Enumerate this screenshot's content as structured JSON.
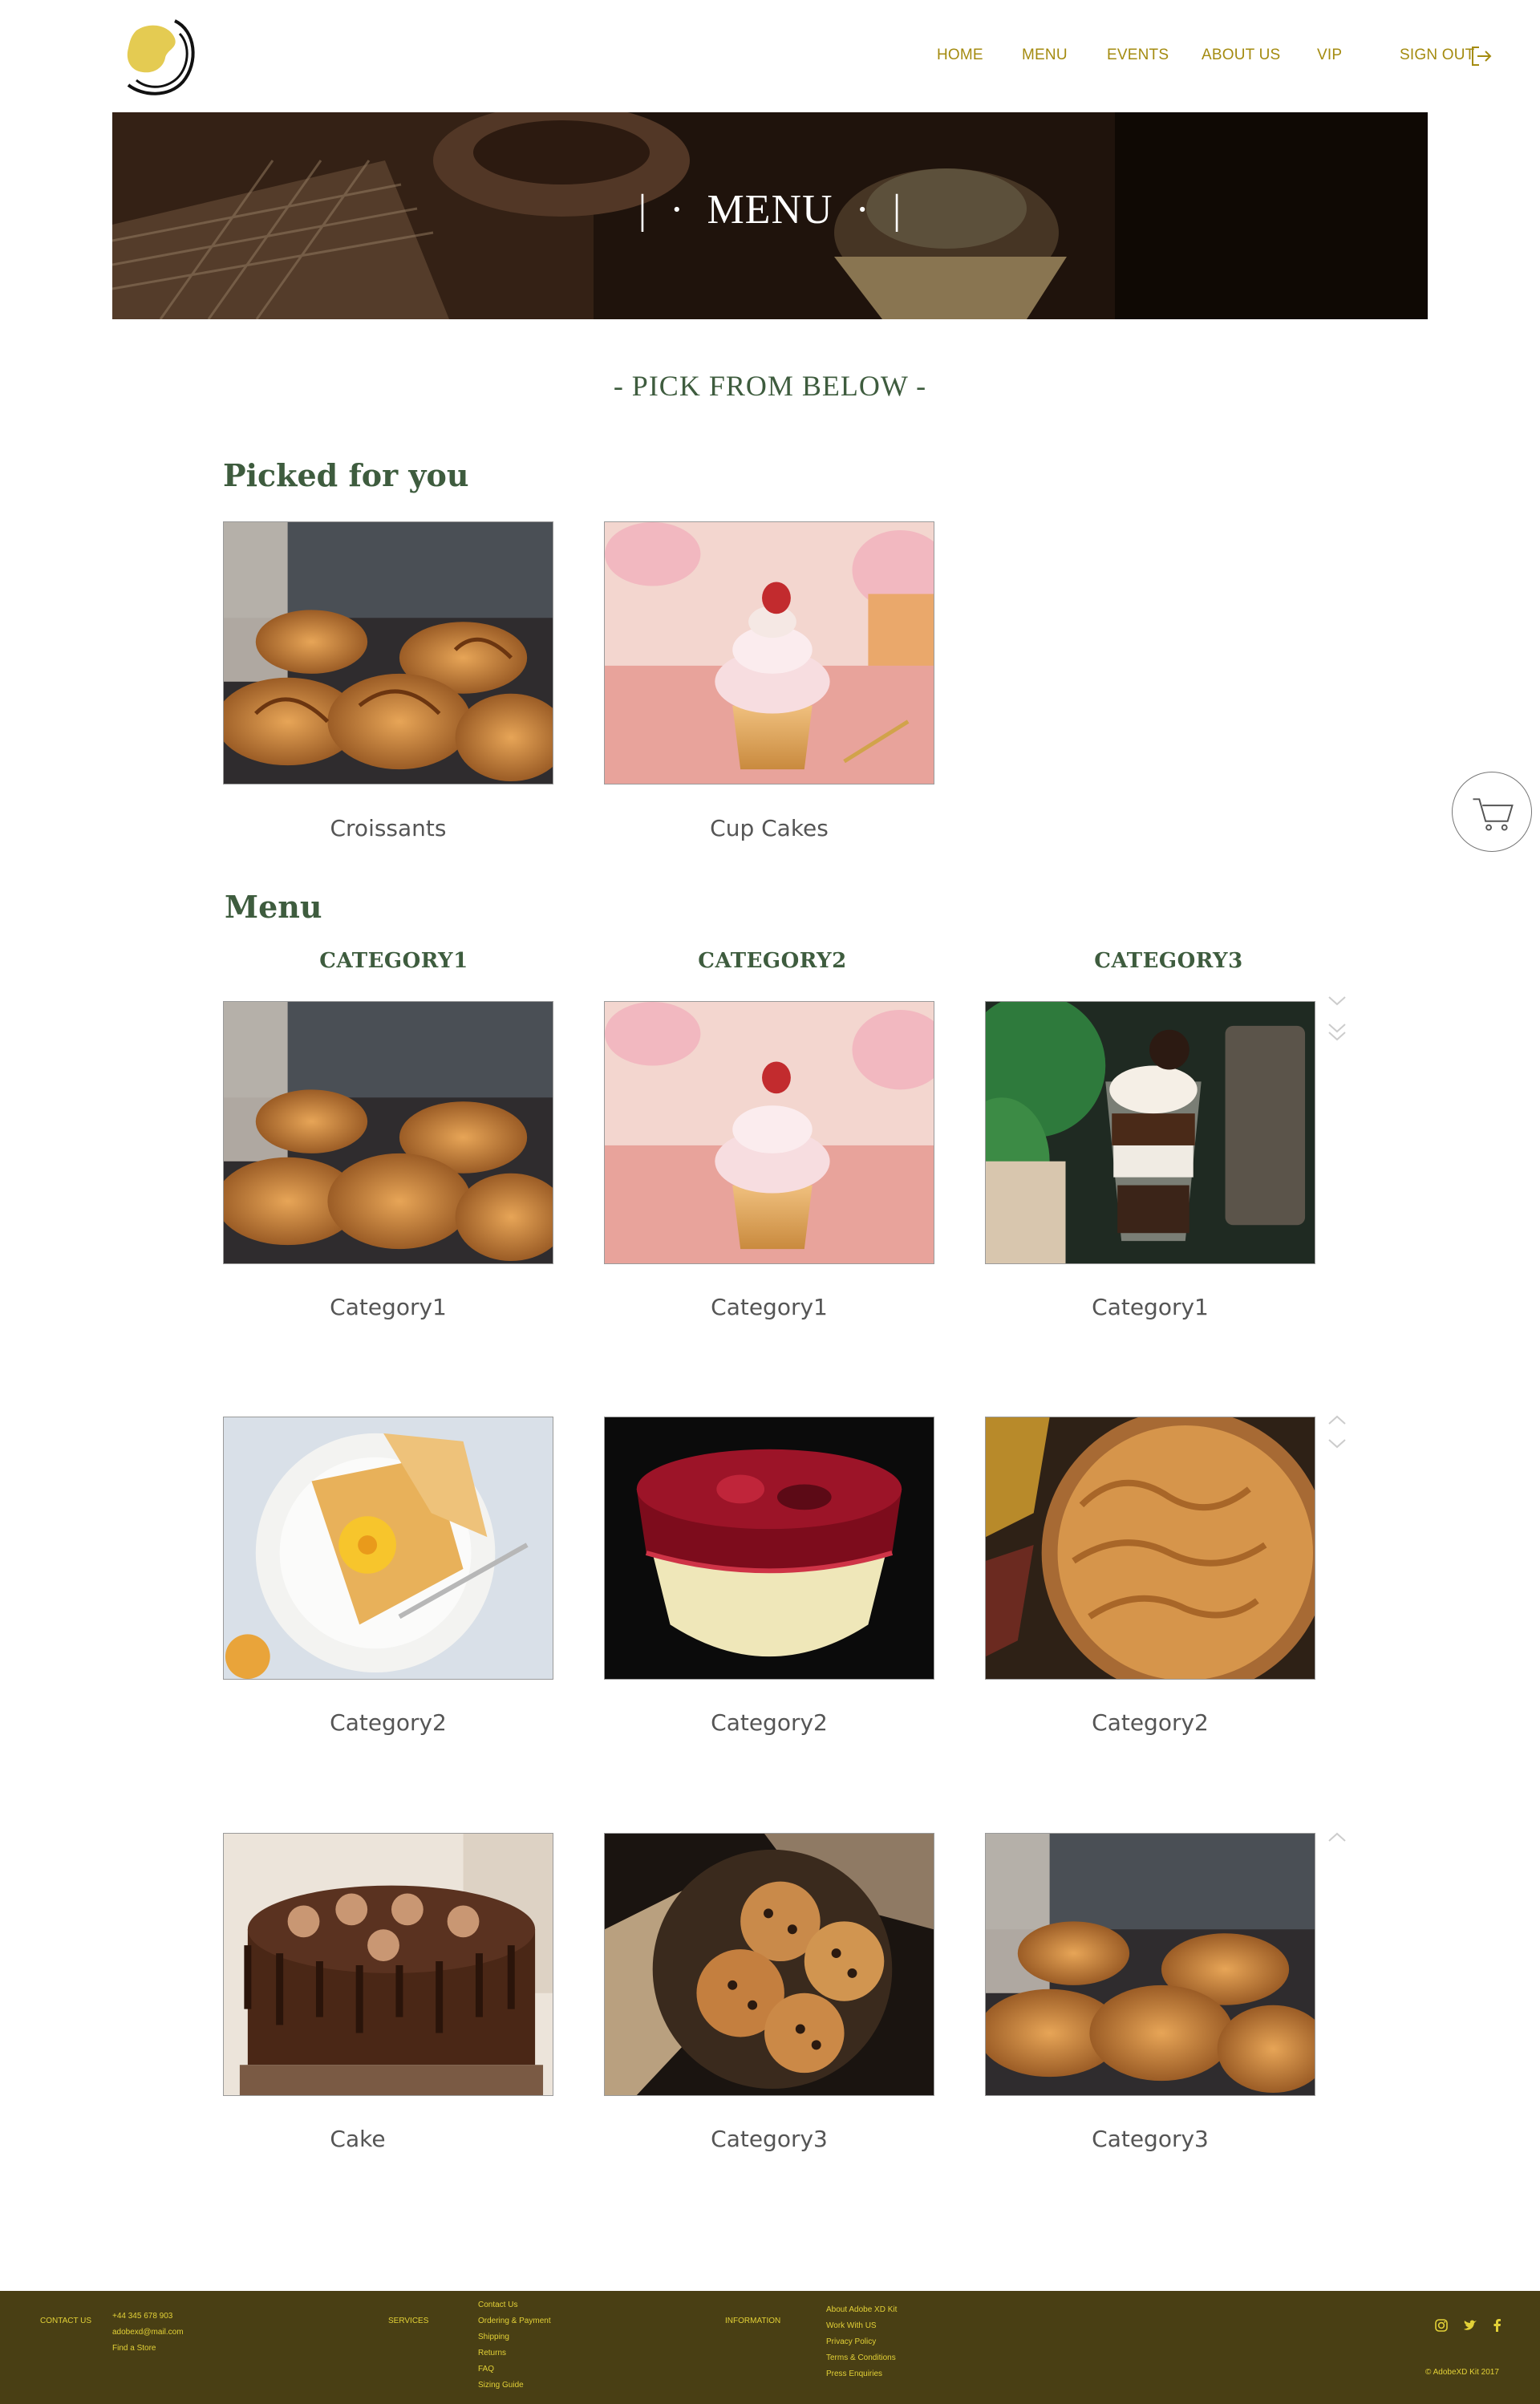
{
  "nav": {
    "items": [
      "HOME",
      "MENU",
      "EVENTS",
      "ABOUT US",
      "VIP"
    ],
    "sign_out": "SIGN OUT"
  },
  "hero": {
    "title": "|  ·  MENU  ·  |"
  },
  "pick": {
    "heading": "- PICK FROM BELOW -"
  },
  "picked": {
    "title": "Picked for you",
    "items": [
      {
        "caption": "Croissants",
        "image": "croissants"
      },
      {
        "caption": "Cup Cakes",
        "image": "cupcake"
      }
    ]
  },
  "menu": {
    "title": "Menu",
    "categories": [
      "CATEGORY1",
      "CATEGORY2",
      "CATEGORY3"
    ],
    "rows": [
      [
        {
          "caption": "Category1",
          "image": "croissants"
        },
        {
          "caption": "Category1",
          "image": "cupcake"
        },
        {
          "caption": "Category1",
          "image": "parfait"
        }
      ],
      [
        {
          "caption": "Category2",
          "image": "crepes"
        },
        {
          "caption": "Category2",
          "image": "cherry-dessert"
        },
        {
          "caption": "Category2",
          "image": "pie"
        }
      ],
      [
        {
          "caption": "Cake",
          "image": "chocolate-cake"
        },
        {
          "caption": "Category3",
          "image": "cookies"
        },
        {
          "caption": "Category3",
          "image": "croissants"
        }
      ]
    ]
  },
  "footer": {
    "contact": {
      "label": "CONTACT US",
      "items": [
        "+44 345 678 903",
        "adobexd@mail.com",
        "Find a Store"
      ]
    },
    "services": {
      "label": "SERVICES",
      "items": [
        "Contact Us",
        "Ordering & Payment",
        "Shipping",
        "Returns",
        "FAQ",
        "Sizing Guide"
      ]
    },
    "information": {
      "label": "INFORMATION",
      "items": [
        "About Adobe XD Kit",
        "Work With US",
        "Privacy Policy",
        "Terms & Conditions",
        "Press Enquiries"
      ]
    },
    "copyright": "© AdobeXD Kit 2017",
    "social": [
      "instagram-icon",
      "twitter-icon",
      "facebook-icon"
    ]
  },
  "colors": {
    "nav": "#a48b10",
    "heading_green": "#3e5c3e",
    "footer_bg": "#493f14",
    "footer_text": "#e3d137"
  }
}
